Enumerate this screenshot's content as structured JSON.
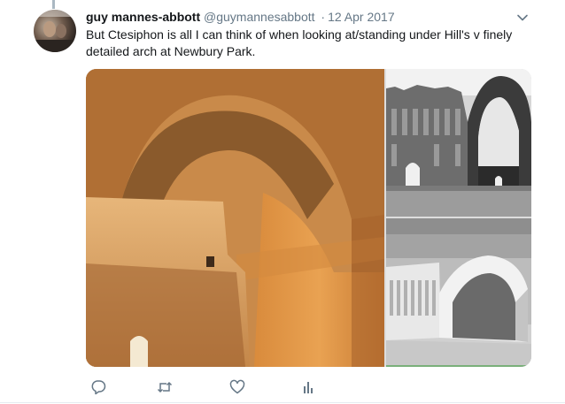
{
  "tweet": {
    "author_name": "guy mannes-abbott",
    "handle": "@guymannesabbott",
    "separator": "·",
    "date": "12 Apr 2017",
    "text": "But Ctesiphon is all I can think of when looking at/standing under Hill's v finely detailed arch at Newbury Park."
  },
  "icons": {
    "menu": "chevron-down-icon",
    "reply": "reply-icon",
    "retweet": "retweet-icon",
    "like": "heart-icon",
    "analytics": "analytics-icon"
  },
  "colors": {
    "icon": "#657786",
    "thread_line": "#aab8c2",
    "text": "#14171a"
  }
}
